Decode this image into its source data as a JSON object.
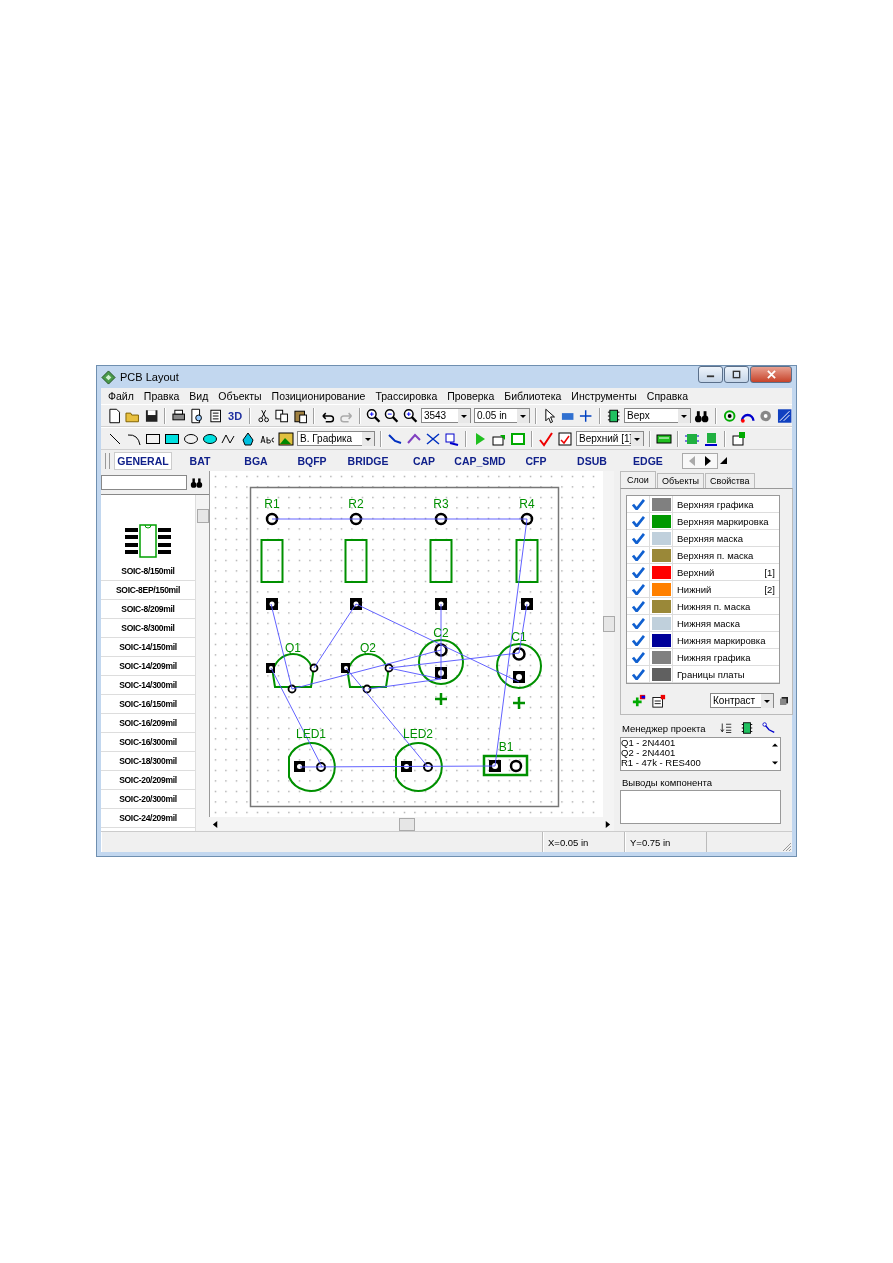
{
  "window": {
    "title": "PCB Layout"
  },
  "menu": [
    "Файл",
    "Правка",
    "Вид",
    "Объекты",
    "Позиционирование",
    "Трассировка",
    "Проверка",
    "Библиотека",
    "Инструменты",
    "Справка"
  ],
  "toolbar_1": {
    "view_3d": "3D",
    "zoom": "3543",
    "grid": "0.05 in",
    "layer": "Верх"
  },
  "toolbar_2": {
    "draw_layer": "В. Графика",
    "route_layer": "Верхний [1]"
  },
  "library_tabs": [
    {
      "label": "GENERAL",
      "selected": true
    },
    {
      "label": "BAT",
      "selected": false
    },
    {
      "label": "BGA",
      "selected": false
    },
    {
      "label": "BQFP",
      "selected": false
    },
    {
      "label": "BRIDGE",
      "selected": false
    },
    {
      "label": "CAP",
      "selected": false
    },
    {
      "label": "CAP_SMD",
      "selected": false
    },
    {
      "label": "CFP",
      "selected": false
    },
    {
      "label": "DSUB",
      "selected": false
    },
    {
      "label": "EDGE",
      "selected": false
    }
  ],
  "library": {
    "preview_label": "SOIC-8/150mil",
    "items": [
      "SOIC-8EP/150mil",
      "SOIC-8/209mil",
      "SOIC-8/300mil",
      "SOIC-14/150mil",
      "SOIC-14/209mil",
      "SOIC-14/300mil",
      "SOIC-16/150mil",
      "SOIC-16/209mil",
      "SOIC-16/300mil",
      "SOIC-18/300mil",
      "SOIC-20/209mil",
      "SOIC-20/300mil",
      "SOIC-24/209mil"
    ]
  },
  "components": [
    {
      "kind": "resistor",
      "label": "R1"
    },
    {
      "kind": "resistor",
      "label": "R2"
    },
    {
      "kind": "resistor",
      "label": "R3"
    },
    {
      "kind": "resistor",
      "label": "R4"
    },
    {
      "kind": "transistor",
      "label": "Q1"
    },
    {
      "kind": "transistor",
      "label": "Q2"
    },
    {
      "kind": "capacitor",
      "label": "C2"
    },
    {
      "kind": "capacitor",
      "label": "C1"
    },
    {
      "kind": "led",
      "label": "LED1"
    },
    {
      "kind": "led",
      "label": "LED2"
    },
    {
      "kind": "battery",
      "label": "B1"
    }
  ],
  "panel_tabs": [
    {
      "label": "Слои",
      "selected": true
    },
    {
      "label": "Объекты",
      "selected": false
    },
    {
      "label": "Свойства",
      "selected": false
    }
  ],
  "layers": [
    {
      "name": "Верхняя графика",
      "checked": true,
      "color": "#808080"
    },
    {
      "name": "Верхняя маркировка",
      "checked": true,
      "color": "#009900"
    },
    {
      "name": "Верхняя маска",
      "checked": true,
      "color": "#c0d0dc"
    },
    {
      "name": "Верхняя п. маска",
      "checked": true,
      "color": "#9a8838"
    },
    {
      "name": "Верхний",
      "number": "[1]",
      "checked": true,
      "color": "#ff0000"
    },
    {
      "name": "Нижний",
      "number": "[2]",
      "checked": true,
      "color": "#ff8000"
    },
    {
      "name": "Нижняя п. маска",
      "checked": true,
      "color": "#9a8838"
    },
    {
      "name": "Нижняя маска",
      "checked": true,
      "color": "#c0d0dc"
    },
    {
      "name": "Нижняя маркировка",
      "checked": true,
      "color": "#000099"
    },
    {
      "name": "Нижняя графика",
      "checked": true,
      "color": "#808080"
    },
    {
      "name": "Границы платы",
      "checked": true,
      "color": "#606060"
    }
  ],
  "view_mode": "Контраст",
  "project_manager": {
    "title": "Менеджер проекта",
    "items": [
      "Q1 - 2N4401",
      "Q2 - 2N4401",
      "R1 - 47k - RES400"
    ]
  },
  "pins": {
    "title": "Выводы компонента"
  },
  "status_bar": {
    "x": "X=0.05 in",
    "y": "Y=0.75 in"
  }
}
